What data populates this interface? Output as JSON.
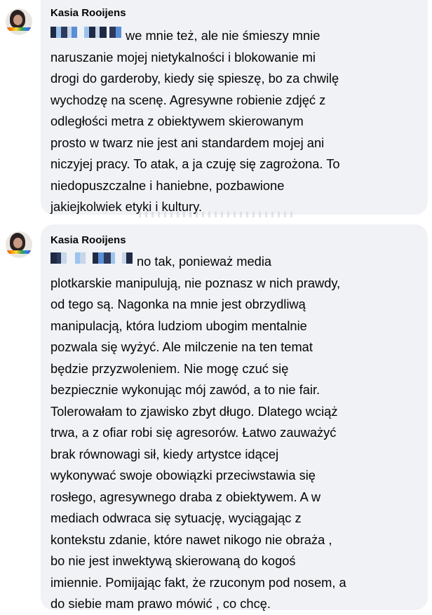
{
  "comments": [
    {
      "author": "Kasia Rooijens",
      "lines": [
        "we mnie też, ale nie śmieszy mnie",
        "naruszanie mojej nietykalności i blokowanie mi",
        "drogi do garderoby, kiedy się spieszę, bo za chwilę",
        "wychodzę na scenę. Agresywne robienie zdjęć z",
        "odległości metra z obiektywem skierowanym",
        "prosto w twarz nie jest ani standardem mojej ani",
        "niczyjej pracy. To atak, a ja czuję się zagrożona. To",
        "niedopuszczalne i haniebne, pozbawione",
        "jakiejkolwiek etyki i kultury."
      ]
    },
    {
      "author": "Kasia Rooijens",
      "lines": [
        "no tak, ponieważ media",
        "plotkarskie manipulują, nie poznasz w nich prawdy,",
        "od tego są. Nagonka na mnie jest obrzydliwą",
        "manipulacją, która ludziom ubogim mentalnie",
        "pozwala się wyżyć. Ale milczenie na ten temat",
        "będzie przyzwoleniem. Nie mogę czuć się",
        "bezpiecznie wykonując mój zawód, a to nie fair.",
        "Tolerowałam to zjawisko zbyt długo. Dlatego wciąż",
        "trwa, a z ofiar robi się agresorów. Łatwo zauważyć",
        "brak równowagi sił, kiedy artystce idącej",
        "wykonywać swoje obowiązki przeciwstawia się",
        "rosłego, agresywnego draba z obiektywem. A w",
        "mediach odwraca się sytuację, wyciągając z",
        "kontekstu zdanie, które nawet nikogo nie obraża ,",
        "bo nie jest inwektywą skierowaną do kogoś",
        "imiennie. Pomijając fakt, że rzuconym pod nosem, a",
        "do siebie mam prawo mówić , co chcę."
      ]
    }
  ],
  "colors": {
    "bubble": "#f0f2f5",
    "text": "#050505",
    "mention_blur": [
      "#1f2a44",
      "#5b8fd6",
      "#9cc3ee",
      "#2d3a5c",
      "#c7d6ea"
    ]
  }
}
